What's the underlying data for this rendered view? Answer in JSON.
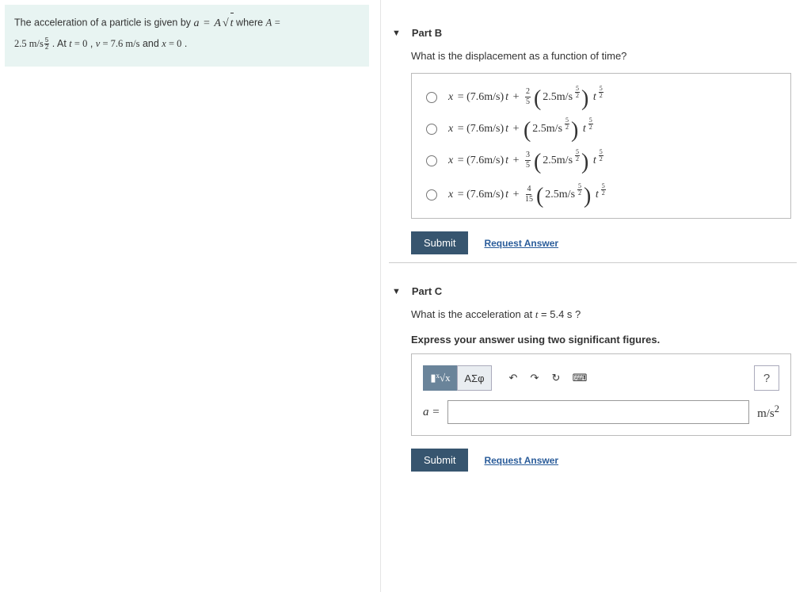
{
  "problem": {
    "line1_prefix": "The acceleration of a particle is given by ",
    "formula_a": "a = A√t",
    "where": " where ",
    "A_eq": "A = ",
    "A_val": "2.5 m/s",
    "A_exp_num": "5",
    "A_exp_den": "2",
    "line2_cont": " . At ",
    "t0": "t = 0",
    "comma": ", ",
    "v_eq": "v = 7.6 m/s",
    "and": " and ",
    "x_eq": "x = 0",
    "period": "."
  },
  "partB": {
    "title": "Part B",
    "question": "What is the displacement as a function of time?",
    "choices": [
      {
        "coef_num": "2",
        "coef_den": "5",
        "show_coef": true
      },
      {
        "coef_num": "",
        "coef_den": "",
        "show_coef": false
      },
      {
        "coef_num": "3",
        "coef_den": "5",
        "show_coef": true
      },
      {
        "coef_num": "4",
        "coef_den": "15",
        "show_coef": true
      }
    ],
    "base_lhs": "x = (7.6m/s)t + ",
    "A_in_paren": "2.5m/s",
    "exp_num": "5",
    "exp_den": "2",
    "t_exp_num": "5",
    "t_exp_den": "2",
    "submit": "Submit",
    "request": "Request Answer"
  },
  "partC": {
    "title": "Part C",
    "question": "What is the acceleration at t = 5.4 s ?",
    "instruction": "Express your answer using two significant figures.",
    "toolbar": {
      "templates_label": "▮√x",
      "greek_label": "ΑΣφ",
      "undo": "↶",
      "redo": "↷",
      "reset": "↻",
      "keyboard": "⌨",
      "help": "?"
    },
    "lhs": "a = ",
    "unit": "m/s²",
    "submit": "Submit",
    "request": "Request Answer"
  }
}
